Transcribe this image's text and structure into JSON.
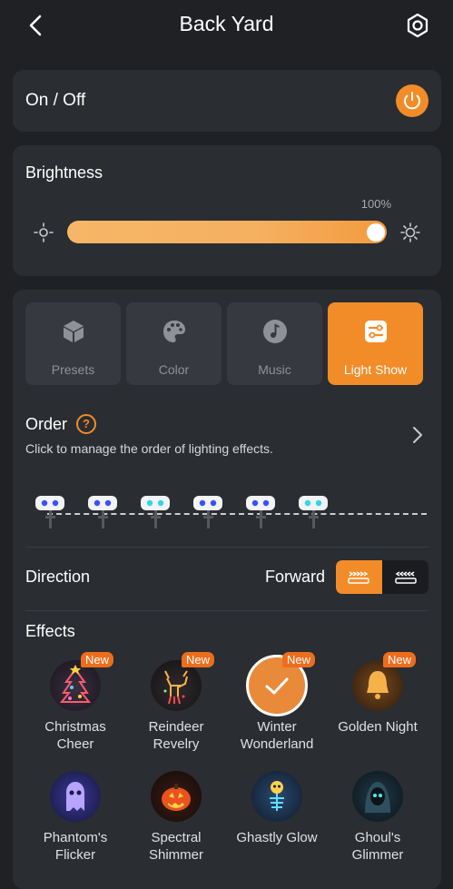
{
  "header": {
    "title": "Back Yard"
  },
  "power": {
    "label": "On / Off",
    "state": "on"
  },
  "brightness": {
    "title": "Brightness",
    "value": "100%",
    "level": 1.0
  },
  "tabs": [
    {
      "label": "Presets",
      "icon": "cube-icon",
      "active": false
    },
    {
      "label": "Color",
      "icon": "palette-icon",
      "active": false
    },
    {
      "label": "Music",
      "icon": "music-note-icon",
      "active": false
    },
    {
      "label": "Light Show",
      "icon": "sliders-icon",
      "active": true
    }
  ],
  "order": {
    "title": "Order",
    "description": "Click to manage the order of lighting effects.",
    "lamp_colors": [
      "#3a4fff",
      "#3a4fff",
      "#31d6e8",
      "#3a4fff",
      "#3a4fff",
      "#31d6e8"
    ]
  },
  "direction": {
    "label": "Direction",
    "value": "Forward"
  },
  "effects": {
    "title": "Effects",
    "items": [
      {
        "line1": "Christmas",
        "line2": "Cheer",
        "badge": "New",
        "selected": false
      },
      {
        "line1": "Reindeer",
        "line2": "Revelry",
        "badge": "New",
        "selected": false
      },
      {
        "line1": "Winter",
        "line2": "Wonderland",
        "badge": "New",
        "selected": true
      },
      {
        "line1": "Golden Night",
        "line2": "",
        "badge": "New",
        "selected": false
      },
      {
        "line1": "Phantom's",
        "line2": "Flicker",
        "badge": "",
        "selected": false
      },
      {
        "line1": "Spectral",
        "line2": "Shimmer",
        "badge": "",
        "selected": false
      },
      {
        "line1": "Ghastly Glow",
        "line2": "",
        "badge": "",
        "selected": false
      },
      {
        "line1": "Ghoul's",
        "line2": "Glimmer",
        "badge": "",
        "selected": false
      }
    ]
  },
  "colors": {
    "accent": "#f28c28",
    "card": "#2a2d31",
    "background": "#1f2124"
  }
}
